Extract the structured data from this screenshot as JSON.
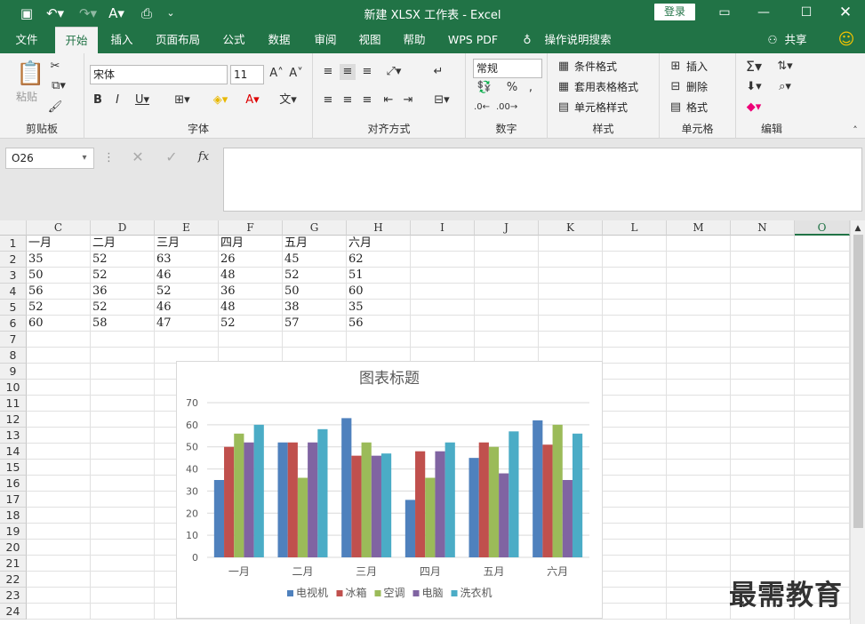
{
  "app": {
    "title": "新建 XLSX 工作表  -  Excel",
    "login_label": "登录"
  },
  "tabs": [
    "文件",
    "开始",
    "插入",
    "页面布局",
    "公式",
    "数据",
    "审阅",
    "视图",
    "帮助",
    "WPS PDF",
    "操作说明搜索"
  ],
  "share_label": "共享",
  "ribbon": {
    "clipboard": {
      "label": "剪贴板",
      "paste": "粘贴"
    },
    "font": {
      "label": "字体",
      "name": "宋体",
      "size": "11"
    },
    "alignment": {
      "label": "对齐方式"
    },
    "number": {
      "label": "数字",
      "format": "常规"
    },
    "styles": {
      "label": "样式",
      "conditional": "条件格式",
      "table": "套用表格格式",
      "cell": "单元格样式"
    },
    "cells": {
      "label": "单元格",
      "insert": "插入",
      "delete": "删除",
      "format": "格式"
    },
    "editing": {
      "label": "编辑"
    }
  },
  "formula_bar": {
    "name_box": "O26",
    "fx": "fx",
    "content": ""
  },
  "columns": [
    "C",
    "D",
    "E",
    "F",
    "G",
    "H",
    "I",
    "J",
    "K",
    "L",
    "M",
    "N",
    "O"
  ],
  "rows": [
    "1",
    "2",
    "3",
    "4",
    "5",
    "6",
    "7",
    "8",
    "9",
    "10",
    "11",
    "12",
    "13",
    "14",
    "15",
    "16",
    "17",
    "18",
    "19",
    "20",
    "21",
    "22",
    "23",
    "24"
  ],
  "sheet": [
    [
      "一月",
      "二月",
      "三月",
      "四月",
      "五月",
      "六月"
    ],
    [
      "35",
      "52",
      "63",
      "26",
      "45",
      "62"
    ],
    [
      "50",
      "52",
      "46",
      "48",
      "52",
      "51"
    ],
    [
      "56",
      "36",
      "52",
      "36",
      "50",
      "60"
    ],
    [
      "52",
      "52",
      "46",
      "48",
      "38",
      "35"
    ],
    [
      "60",
      "58",
      "47",
      "52",
      "57",
      "56"
    ]
  ],
  "chart_data": {
    "type": "bar",
    "title": "图表标题",
    "categories": [
      "一月",
      "二月",
      "三月",
      "四月",
      "五月",
      "六月"
    ],
    "ylim": [
      0,
      70
    ],
    "yticks": [
      "0",
      "10",
      "20",
      "30",
      "40",
      "50",
      "60",
      "70"
    ],
    "grid": true,
    "legend": "bottom",
    "series": [
      {
        "name": "电视机",
        "color": "#4f81bd",
        "values": [
          35,
          52,
          63,
          26,
          45,
          62
        ]
      },
      {
        "name": "冰箱",
        "color": "#c0504d",
        "values": [
          50,
          52,
          46,
          48,
          52,
          51
        ]
      },
      {
        "name": "空调",
        "color": "#9bbb59",
        "values": [
          56,
          36,
          52,
          36,
          50,
          60
        ]
      },
      {
        "name": "电脑",
        "color": "#8064a2",
        "values": [
          52,
          52,
          46,
          48,
          38,
          35
        ]
      },
      {
        "name": "洗衣机",
        "color": "#4bacc6",
        "values": [
          60,
          58,
          47,
          52,
          57,
          56
        ]
      }
    ]
  },
  "watermark": "最需教育"
}
